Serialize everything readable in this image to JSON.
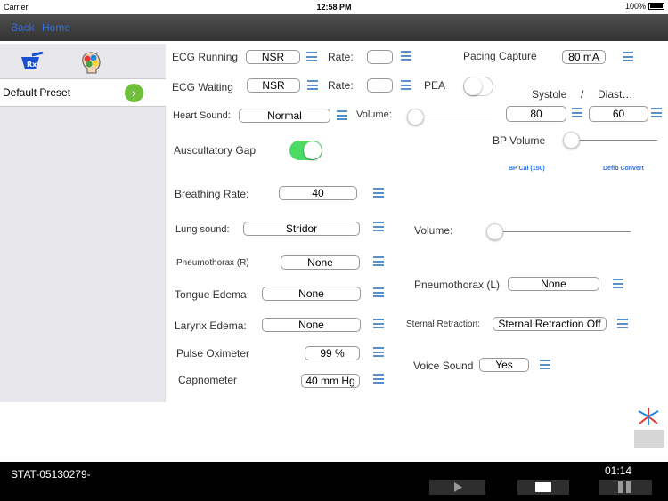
{
  "status": {
    "carrier": "Carrier",
    "time": "12:58 PM",
    "battery": "100%"
  },
  "nav": {
    "back": "Back",
    "home": "Home"
  },
  "sidebar": {
    "preset_label": "Default Preset"
  },
  "ecg": {
    "running_label": "ECG Running",
    "running_value": "NSR",
    "running_rate_label": "Rate:",
    "running_rate_value": "",
    "waiting_label": "ECG Waiting",
    "waiting_value": "NSR",
    "waiting_rate_label": "Rate:",
    "waiting_rate_value": "",
    "pea_label": "PEA",
    "pea_on": false
  },
  "pacing": {
    "label": "Pacing Capture",
    "value": "80 mA"
  },
  "bp": {
    "systole_label": "Systole",
    "separator": "/",
    "diastole_label": "Diast…",
    "systole_value": "80",
    "diastole_value": "60",
    "volume_label": "BP Volume",
    "volume_level": 0,
    "bp_cal_link": "BP Cal (150)",
    "defib_link": "Defib Convert"
  },
  "heart": {
    "label": "Heart Sound:",
    "value": "Normal",
    "volume_label": "Volume:",
    "volume_level": 0
  },
  "auscultatory": {
    "label": "Auscultatory Gap",
    "on": true
  },
  "breathing": {
    "label": "Breathing Rate:",
    "value": "40"
  },
  "lung": {
    "label": "Lung sound:",
    "value": "Stridor",
    "volume_label": "Volume:",
    "volume_level": 0
  },
  "pneumo_r": {
    "label": "Pneumothorax (R)",
    "value": "None"
  },
  "pneumo_l": {
    "label": "Pneumothorax (L)",
    "value": "None"
  },
  "tongue": {
    "label": "Tongue Edema",
    "value": "None"
  },
  "larynx": {
    "label": "Larynx Edema:",
    "value": "None"
  },
  "sternal": {
    "label": "Sternal Retraction:",
    "value": "Sternal Retraction Off"
  },
  "pulse_ox": {
    "label": "Pulse Oximeter",
    "value": "99 %"
  },
  "voice": {
    "label": "Voice Sound",
    "value": "Yes"
  },
  "capno": {
    "label": "Capnometer",
    "value": "40 mm Hg"
  },
  "bottom": {
    "session_id": "STAT-05130279-",
    "timer": "01:14"
  },
  "icons": {
    "rx": "rx-mortar-icon",
    "brain": "brain-puzzle-icon",
    "logo": "starburst-logo-icon",
    "play": "play-icon",
    "stop": "stop-icon",
    "pause": "pause-icon"
  },
  "colors": {
    "accent": "#2f6fe0",
    "switch_on": "#4cd964",
    "menu": "#5b8fc9",
    "go": "#6fbf3a"
  }
}
